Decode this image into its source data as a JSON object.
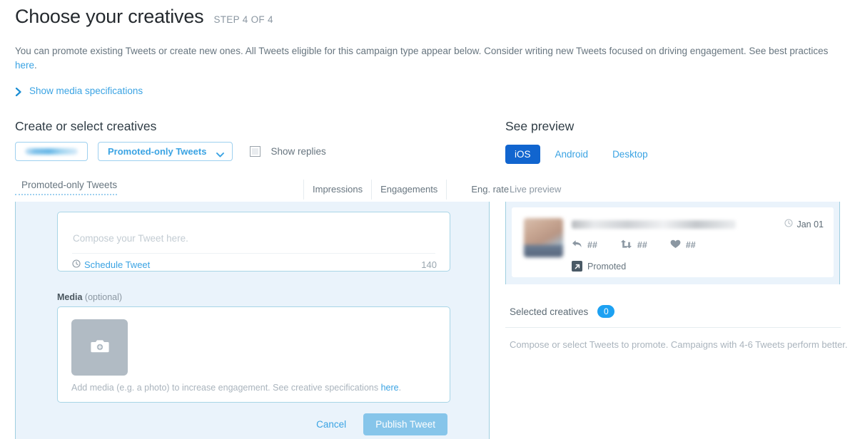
{
  "header": {
    "title": "Choose your creatives",
    "step": "STEP 4 OF 4"
  },
  "intro": {
    "text_before": "You can promote existing Tweets or create new ones. All Tweets eligible for this campaign type appear below. Consider writing new Tweets focused on driving engagement. See best practices ",
    "link": "here",
    "text_after": ".",
    "disclosure_label": "Show media specifications",
    "disclosure_icon": "chevron-right-icon"
  },
  "left": {
    "section_title": "Create or select creatives",
    "account_button_label": "",
    "tweet_type_label": "Promoted-only Tweets",
    "tweet_type_icon": "chevron-down-icon",
    "show_replies_label": "Show replies",
    "show_replies_checked": false,
    "table": {
      "main_header": "Promoted-only Tweets",
      "metric_headers": [
        "Impressions",
        "Engagements",
        "Eng. rate"
      ]
    },
    "composer": {
      "placeholder": "Compose your Tweet here.",
      "value": "",
      "schedule_label": "Schedule Tweet",
      "schedule_icon": "clock-icon",
      "char_count": "140",
      "media_label": "Media",
      "media_optional": "(optional)",
      "media_thumb_icon": "camera-add-icon",
      "media_hint_before": "Add media (e.g. a photo) to increase engagement. See creative specifications ",
      "media_hint_link": "here",
      "media_hint_after": ".",
      "cancel_label": "Cancel",
      "publish_label": "Publish Tweet"
    }
  },
  "right": {
    "section_title": "See preview",
    "platforms": [
      {
        "label": "iOS",
        "active": true
      },
      {
        "label": "Android",
        "active": false
      },
      {
        "label": "Desktop",
        "active": false
      }
    ],
    "live_preview_label": "Live preview",
    "card": {
      "author_name": "",
      "date": "Jan 01",
      "date_icon": "clock-icon",
      "stats": [
        {
          "icon": "reply-icon",
          "count": "##"
        },
        {
          "icon": "retweet-icon",
          "count": "##"
        },
        {
          "icon": "heart-icon",
          "count": "##"
        }
      ],
      "promoted_label": "Promoted",
      "promoted_icon": "arrow-up-right-icon"
    },
    "selected_creatives_label": "Selected creatives",
    "selected_creatives_count": "0",
    "empty_hint": "Compose or select Tweets to promote. Campaigns with 4-6 Tweets perform better."
  },
  "colors": {
    "accent_link": "#3aa3e3",
    "panel_bg": "#eaf3fb",
    "panel_border": "#9fcfe0",
    "active_tab": "#1165cf",
    "badge": "#1da1f2",
    "publish_button": "#86c5ea"
  }
}
